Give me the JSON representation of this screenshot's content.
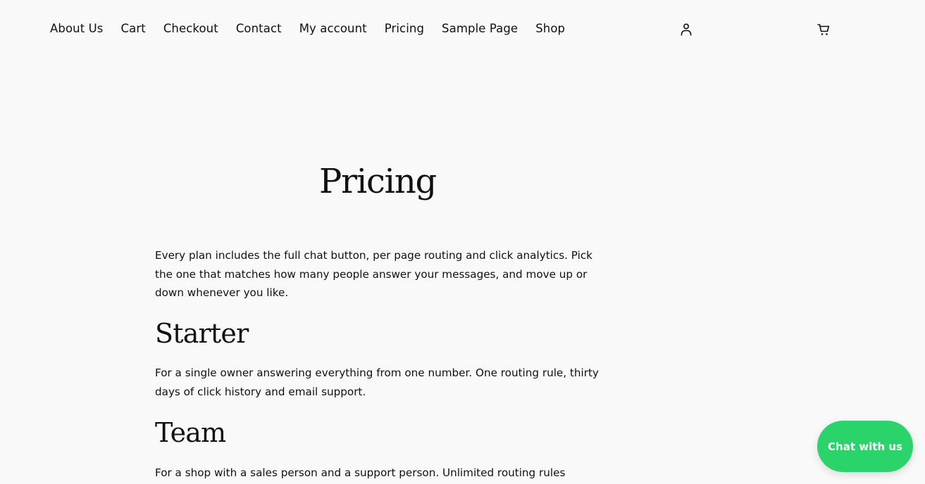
{
  "nav": {
    "items": [
      {
        "label": "About Us"
      },
      {
        "label": "Cart"
      },
      {
        "label": "Checkout"
      },
      {
        "label": "Contact"
      },
      {
        "label": "My account"
      },
      {
        "label": "Pricing"
      },
      {
        "label": "Sample Page"
      },
      {
        "label": "Shop"
      }
    ]
  },
  "header": {
    "icons": {
      "account": "account-icon",
      "cart": "cart-icon"
    }
  },
  "main": {
    "title": "Pricing",
    "intro": "Every plan includes the full chat button, per page routing and click analytics. Pick the one that matches how many people answer your messages, and move up or down whenever you like.",
    "sections": [
      {
        "heading": "Starter",
        "text": "For a single owner answering everything from one number. One routing rule, thirty days of click history and email support."
      },
      {
        "heading": "Team",
        "text": "For a shop with a sales person and a support person. Unlimited routing rules"
      }
    ]
  },
  "chat_widget": {
    "label": "Chat with us",
    "color": "#2bd46b"
  },
  "colors": {
    "background": "#f9f9f9",
    "text": "#111111",
    "accent": "#2bd46b"
  }
}
